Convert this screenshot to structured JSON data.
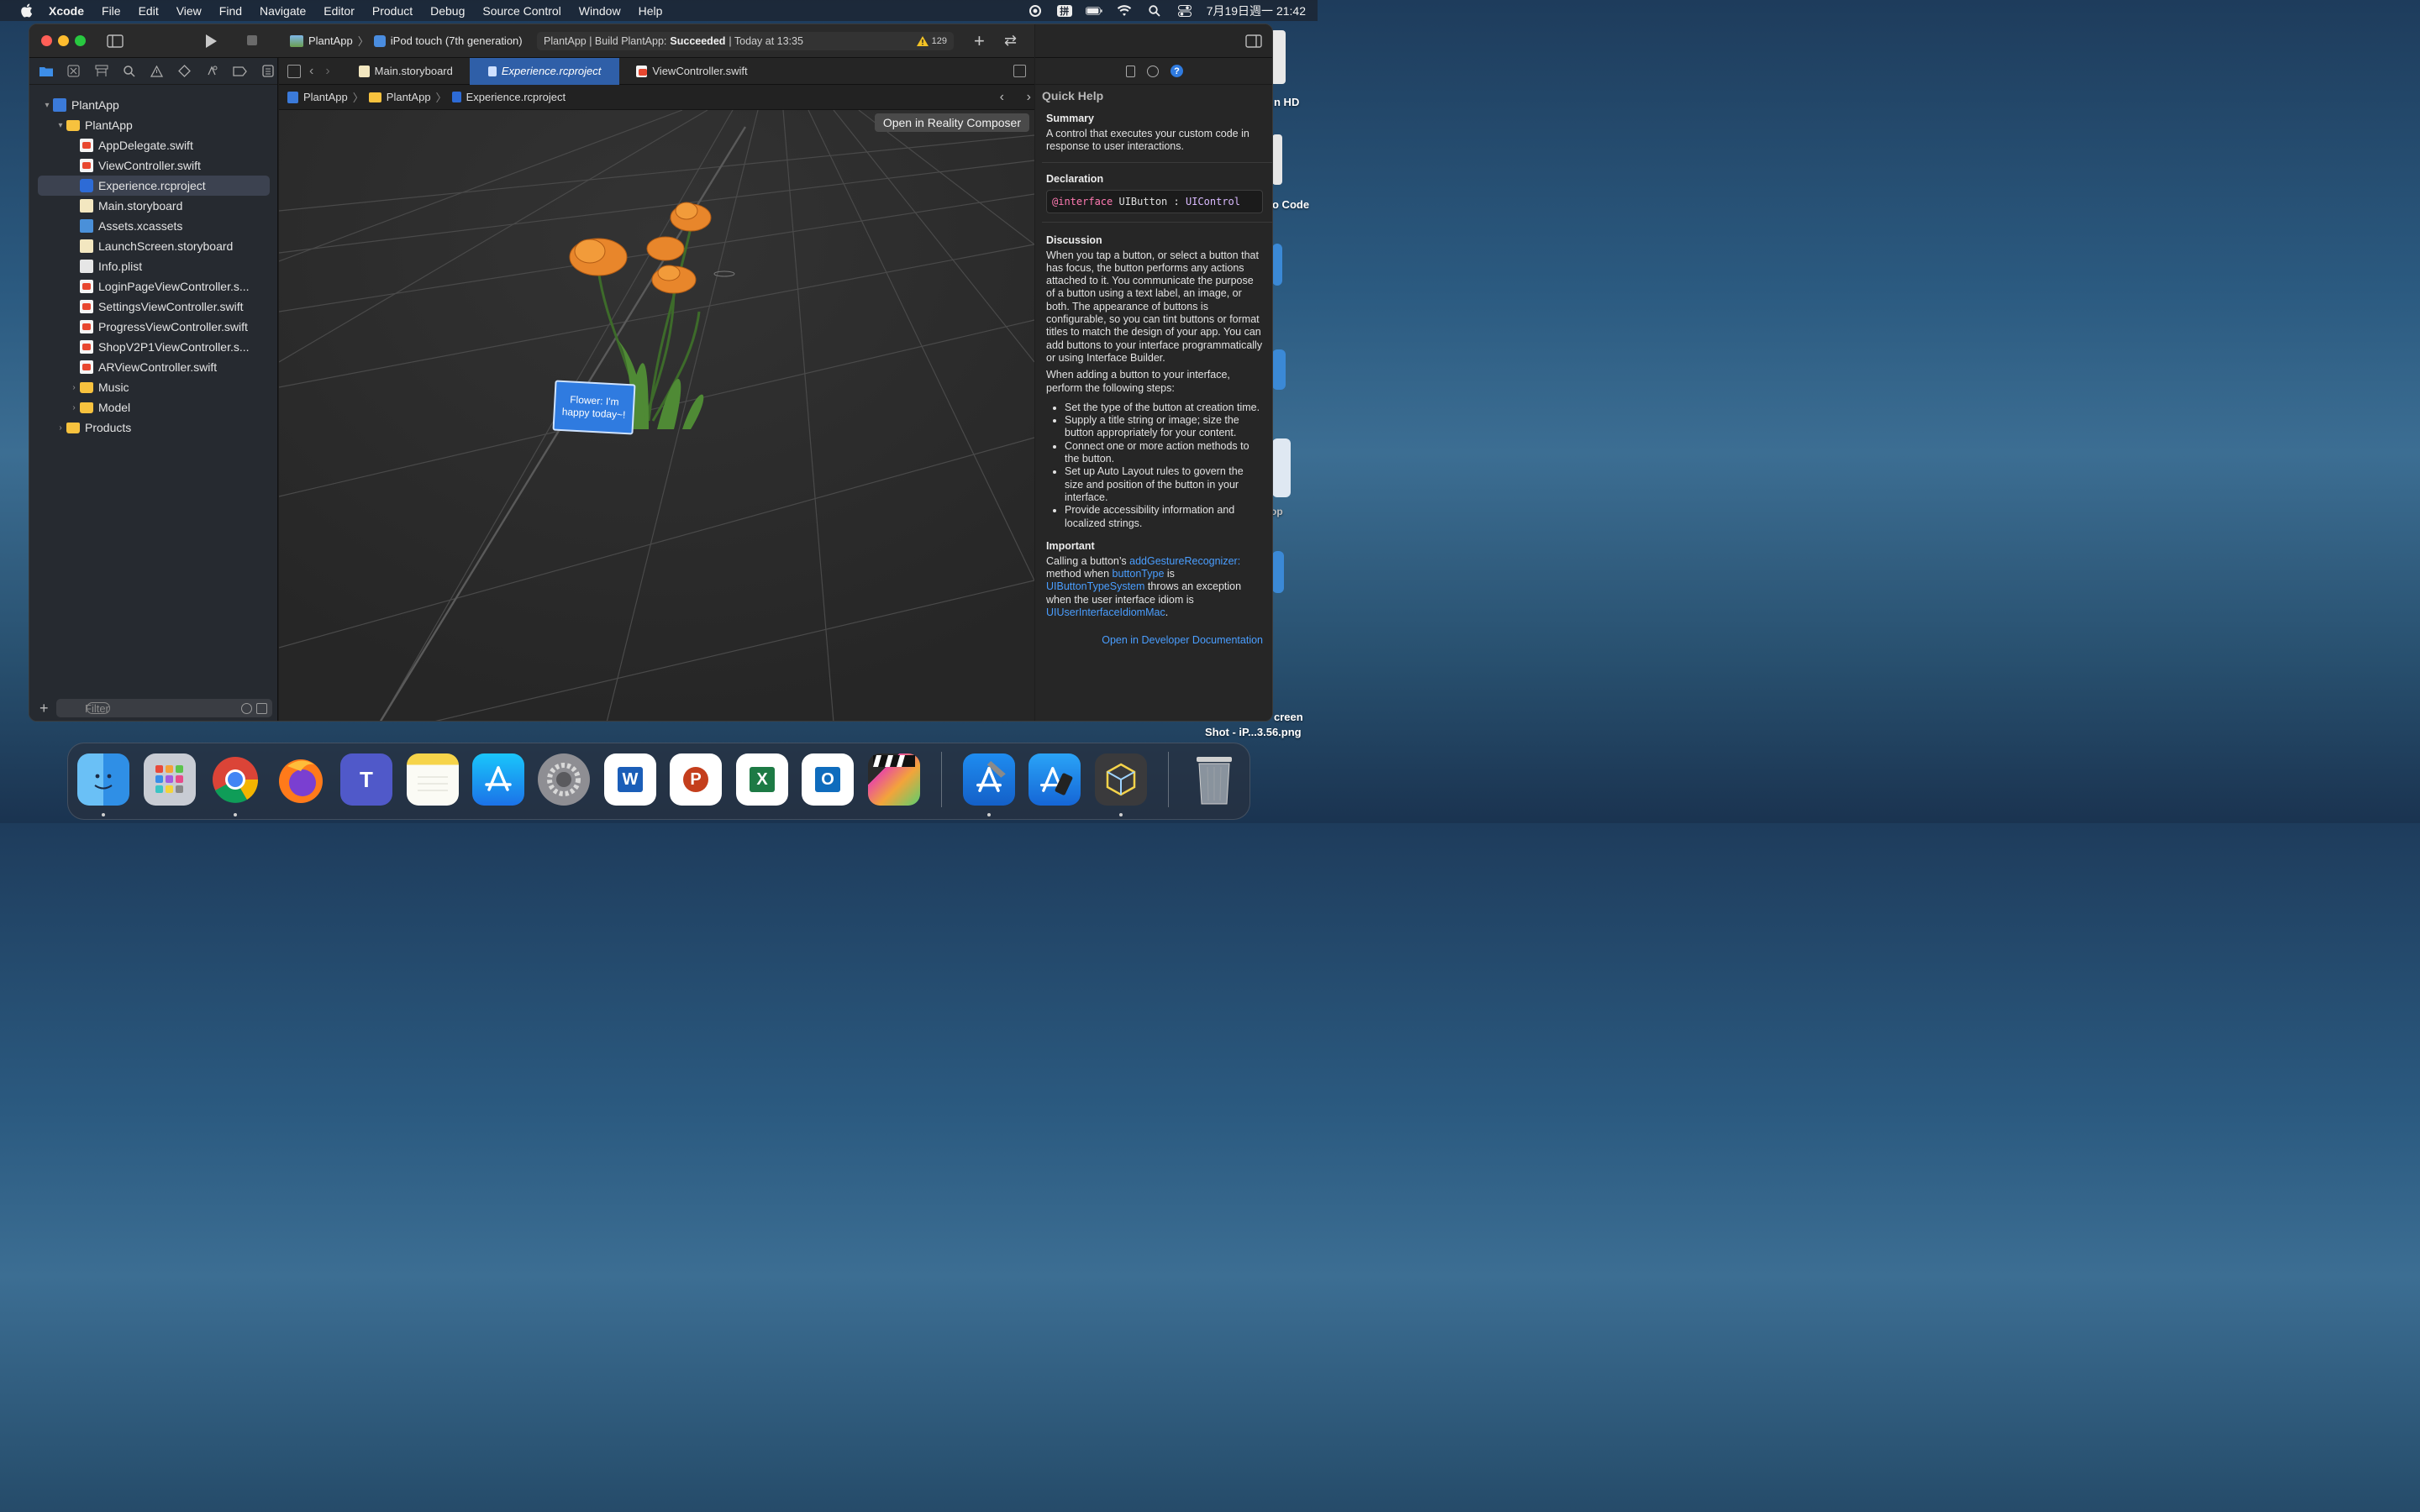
{
  "menubar": {
    "app": "Xcode",
    "items": [
      "File",
      "Edit",
      "View",
      "Find",
      "Navigate",
      "Editor",
      "Product",
      "Debug",
      "Source Control",
      "Window",
      "Help"
    ],
    "clock": "7月19日週一 21:42",
    "ime": "拼"
  },
  "desktop": {
    "labels": [
      "n HD",
      "o Code",
      "op",
      "creen",
      "Shot - iP...3.56.png"
    ]
  },
  "toolbar": {
    "project": "PlantApp",
    "device": "iPod touch (7th generation)",
    "status_prefix": "PlantApp | Build PlantApp:",
    "status_result": "Succeeded",
    "status_time": "| Today at 13:35",
    "warning_count": "129"
  },
  "navigator": {
    "tree": [
      {
        "label": "PlantApp",
        "icon": "project-icon",
        "level": 0,
        "disc": "▾"
      },
      {
        "label": "PlantApp",
        "icon": "folder-icon",
        "level": 1,
        "disc": "▾"
      },
      {
        "label": "AppDelegate.swift",
        "icon": "swift-file-icon",
        "level": 2,
        "disc": ""
      },
      {
        "label": "ViewController.swift",
        "icon": "swift-file-icon",
        "level": 2,
        "disc": ""
      },
      {
        "label": "Experience.rcproject",
        "icon": "reality-composer-icon",
        "level": 2,
        "disc": "",
        "selected": true
      },
      {
        "label": "Main.storyboard",
        "icon": "storyboard-icon",
        "level": 2,
        "disc": ""
      },
      {
        "label": "Assets.xcassets",
        "icon": "asset-catalog-icon",
        "level": 2,
        "disc": ""
      },
      {
        "label": "LaunchScreen.storyboard",
        "icon": "storyboard-icon",
        "level": 2,
        "disc": ""
      },
      {
        "label": "Info.plist",
        "icon": "plist-icon",
        "level": 2,
        "disc": ""
      },
      {
        "label": "LoginPageViewController.s...",
        "icon": "swift-file-icon",
        "level": 2,
        "disc": ""
      },
      {
        "label": "SettingsViewController.swift",
        "icon": "swift-file-icon",
        "level": 2,
        "disc": ""
      },
      {
        "label": "ProgressViewController.swift",
        "icon": "swift-file-icon",
        "level": 2,
        "disc": ""
      },
      {
        "label": "ShopV2P1ViewController.s...",
        "icon": "swift-file-icon",
        "level": 2,
        "disc": ""
      },
      {
        "label": "ARViewController.swift",
        "icon": "swift-file-icon",
        "level": 2,
        "disc": ""
      },
      {
        "label": "Music",
        "icon": "folder-icon",
        "level": 2,
        "disc": "›"
      },
      {
        "label": "Model",
        "icon": "folder-icon",
        "level": 2,
        "disc": "›"
      },
      {
        "label": "Products",
        "icon": "folder-icon",
        "level": 1,
        "disc": "›"
      }
    ],
    "filter_placeholder": "Filter"
  },
  "editor": {
    "tabs": [
      {
        "label": "Main.storyboard",
        "active": false
      },
      {
        "label": "Experience.rcproject",
        "active": true
      },
      {
        "label": "ViewController.swift",
        "active": false
      }
    ],
    "breadcrumb": [
      "PlantApp",
      "PlantApp",
      "Experience.rcproject"
    ],
    "open_button": "Open in Reality Composer",
    "scene_button_line1": "Flower: I'm",
    "scene_button_line2": "happy today~!"
  },
  "quickhelp": {
    "title": "Quick Help",
    "summary_h": "Summary",
    "summary": "A control that executes your custom code in response to user interactions.",
    "declaration_h": "Declaration",
    "decl_kw": "@interface",
    "decl_name": "UIButton",
    "decl_colon": ":",
    "decl_super": "UIControl",
    "discussion_h": "Discussion",
    "discussion_p1": "When you tap a button, or select a button that has focus, the button performs any actions attached to it. You communicate the purpose of a button using a text label, an image, or both. The appearance of buttons is configurable, so you can tint buttons or format titles to match the design of your app. You can add buttons to your interface programmatically or using Interface Builder.",
    "discussion_p2": "When adding a button to your interface, perform the following steps:",
    "steps": [
      "Set the type of the button at creation time.",
      "Supply a title string or image; size the button appropriately for your content.",
      "Connect one or more action methods to the button.",
      "Set up Auto Layout rules to govern the size and position of the button in your interface.",
      "Provide accessibility information and localized strings."
    ],
    "important_h": "Important",
    "imp_1": "Calling a button’s",
    "imp_link1": "addGestureRecognizer:",
    "imp_2": "method when",
    "imp_link2": "buttonType",
    "imp_3": "is",
    "imp_link3": "UIButtonTypeSystem",
    "imp_4": "throws an exception when the user interface idiom is",
    "imp_link4": "UIUserInterfaceIdiomMac",
    "imp_5": ".",
    "doc_link": "Open in Developer Documentation"
  },
  "dock": {
    "apps": [
      "Finder",
      "Launchpad",
      "Chrome",
      "Firefox",
      "Teams",
      "Notes",
      "App Store",
      "System Preferences",
      "Word",
      "PowerPoint",
      "Excel",
      "Outlook",
      "Final Cut Pro",
      "Xcode",
      "Simulator",
      "Reality Composer",
      "Trash"
    ],
    "letters": {
      "word": "W",
      "powerpoint": "P",
      "excel": "X",
      "outlook": "O",
      "teams": "T"
    }
  }
}
